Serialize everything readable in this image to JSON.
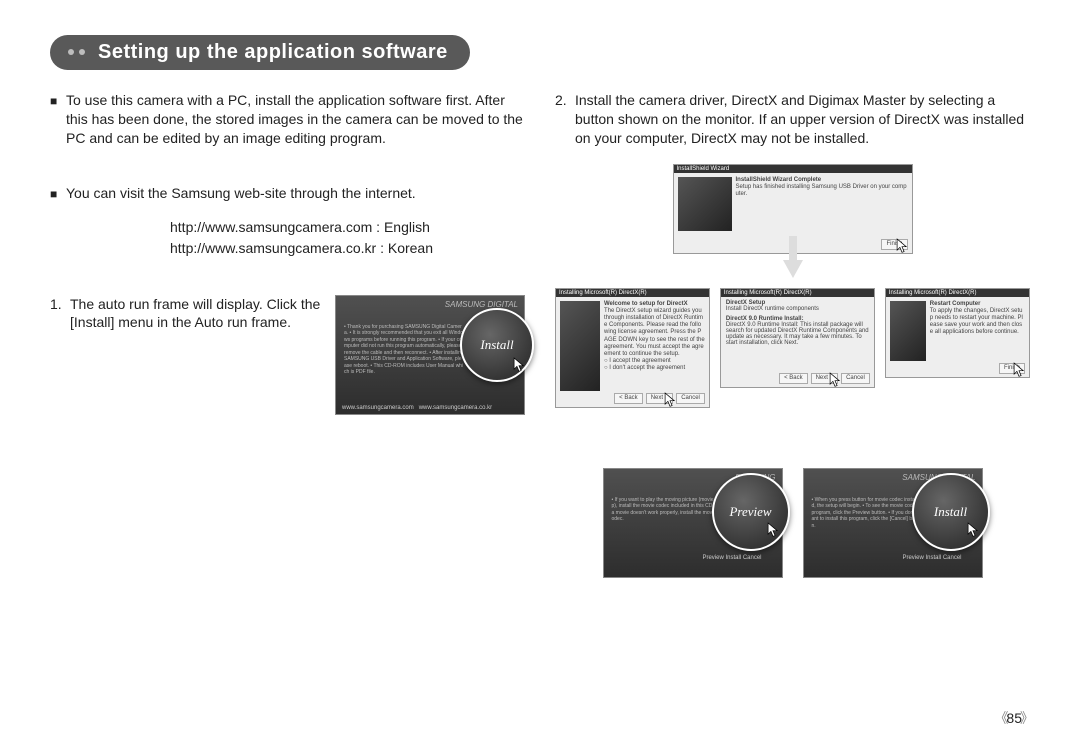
{
  "heading": "Setting up the application software",
  "left": {
    "intro1": "To use this camera with a PC, install the application software first. After this has been done, the stored images in the camera can be moved to the PC and can be edited by an image editing program.",
    "intro2": "You can visit the Samsung web-site through the internet.",
    "url_en": "http://www.samsungcamera.com : English",
    "url_kr": "http://www.samsungcamera.co.kr : Korean",
    "step1_num": "1.",
    "step1": "The auto run frame will display. Click the [Install] menu in the Auto run frame.",
    "autorun_shot": {
      "brand": "SAMSUNG DIGITAL",
      "body_hint": "• Thank you for purchasing SAMSUNG Digital Camera. • It is strongly recommended that you exit all Windows programs before running this program. • If your computer did not run this program automatically, please remove the cable and then reconnect. • After installing SAMSUNG USB Driver and Application Software, please reboot. • This CD-ROM includes User Manual which is PDF file.",
      "zoom_label": "Install",
      "footer1": "www.samsungcamera.com",
      "footer2": "www.samsungcamera.co.kr"
    }
  },
  "right": {
    "step2_num": "2.",
    "step2": "Install the camera driver, DirectX and Digimax Master by selecting a button shown on the monitor. If an upper version of DirectX was installed on your computer, DirectX may not be installed.",
    "dlg_top": {
      "title": "InstallShield Wizard",
      "heading": "InstallShield Wizard Complete",
      "body": "Setup has finished installing Samsung USB Driver on your computer.",
      "btn1": "",
      "btn2": "Finish"
    },
    "dlg_left": {
      "title": "Installing Microsoft(R) DirectX(R)",
      "heading": "Welcome to setup for DirectX",
      "body": "The DirectX setup wizard guides you through installation of DirectX Runtime Components. Please read the following license agreement. Press the PAGE DOWN key to see the rest of the agreement. You must accept the agreement to continue the setup.",
      "opt1": "I accept the agreement",
      "opt2": "I don't accept the agreement",
      "btn_back": "< Back",
      "btn_next": "Next >",
      "btn_cancel": "Cancel"
    },
    "dlg_mid": {
      "title": "Installing Microsoft(R) DirectX(R)",
      "heading": "DirectX Setup",
      "sub": "Install DirectX runtime components",
      "body": "DirectX 9.0 Runtime Install: This install package will search for updated DirectX Runtime Components and update as necessary. It may take a few minutes. To start installation, click Next.",
      "btn_back": "< Back",
      "btn_next": "Next >",
      "btn_cancel": "Cancel"
    },
    "dlg_right": {
      "title": "Installing Microsoft(R) DirectX(R)",
      "heading": "Restart Computer",
      "body": "To apply the changes, DirectX setup needs to restart your machine. Please save your work and then close all applications before continue.",
      "btn_finish": "Finish"
    },
    "shot_preview": {
      "brand": "SAMSUNG",
      "body_hint": "• If you want to play the moving picture (movie clip), install the movie codec included in this CD. • If a movie doesn't work properly, install the movie codec.",
      "zoom_label": "Preview",
      "btns": "Preview   Install   Cancel"
    },
    "shot_install": {
      "brand": "SAMSUNG DIGITAL",
      "body_hint": "• When you press button for movie codec installed, the setup will begin. • To see the movie codec program, click the Preview button. • If you don't want to install this program, click the [Cancel] button.",
      "zoom_label": "Install",
      "btns": "Preview   Install   Cancel"
    }
  },
  "page_number": "85"
}
